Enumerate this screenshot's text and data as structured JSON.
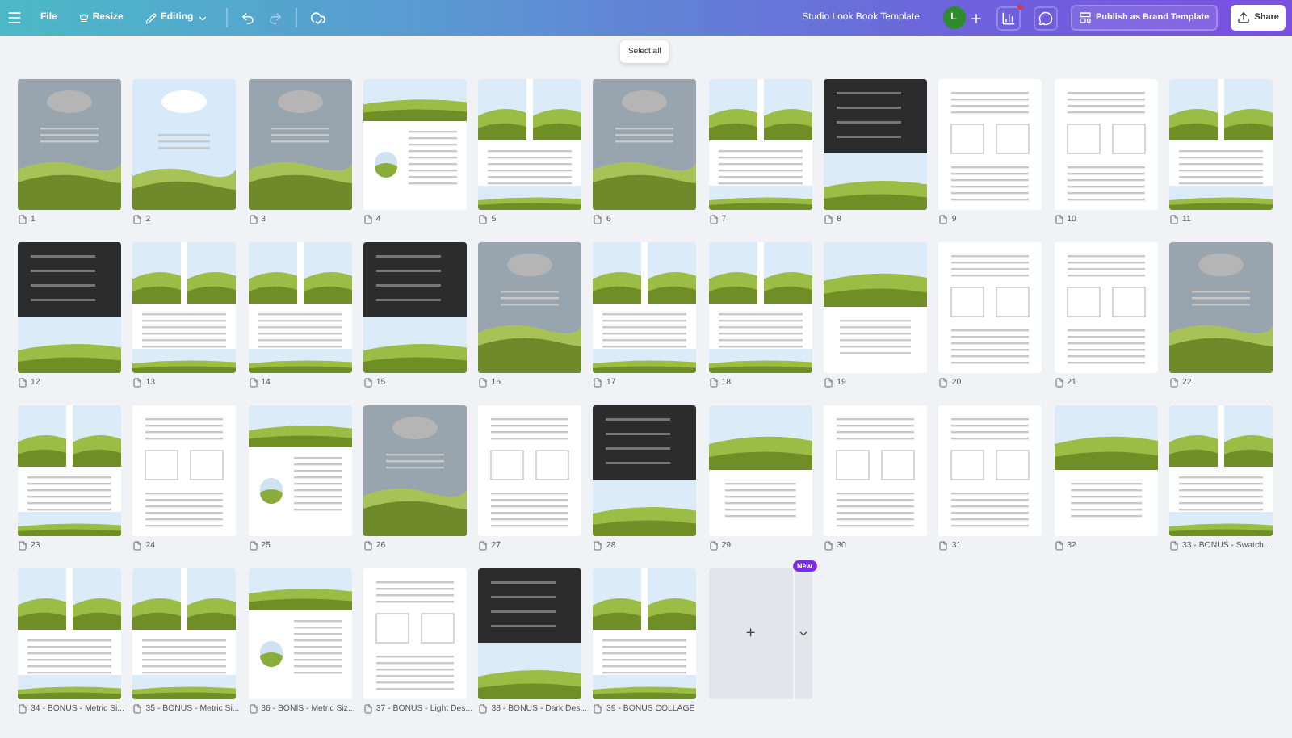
{
  "toolbar": {
    "menu": [
      "File",
      "Resize",
      "Editing"
    ],
    "title": "Studio Look Book Template",
    "avatar": "L",
    "publish": "Publish as Brand Template",
    "share": "Share"
  },
  "tooltip": "Select all",
  "pages": [
    {
      "label": "1",
      "kind": "grey"
    },
    {
      "label": "2",
      "kind": "sky"
    },
    {
      "label": "3",
      "kind": "grey"
    },
    {
      "label": "4",
      "kind": "split"
    },
    {
      "label": "5",
      "kind": "grid"
    },
    {
      "label": "6",
      "kind": "grey"
    },
    {
      "label": "7",
      "kind": "grid"
    },
    {
      "label": "8",
      "kind": "dark"
    },
    {
      "label": "9",
      "kind": "text"
    },
    {
      "label": "10",
      "kind": "text"
    },
    {
      "label": "11",
      "kind": "grid"
    },
    {
      "label": "12",
      "kind": "dark"
    },
    {
      "label": "13",
      "kind": "grid"
    },
    {
      "label": "14",
      "kind": "grid"
    },
    {
      "label": "15",
      "kind": "dark"
    },
    {
      "label": "16",
      "kind": "grey"
    },
    {
      "label": "17",
      "kind": "grid"
    },
    {
      "label": "18",
      "kind": "grid"
    },
    {
      "label": "19",
      "kind": "landscape"
    },
    {
      "label": "20",
      "kind": "text"
    },
    {
      "label": "21",
      "kind": "text"
    },
    {
      "label": "22",
      "kind": "grey"
    },
    {
      "label": "23",
      "kind": "grid"
    },
    {
      "label": "24",
      "kind": "text"
    },
    {
      "label": "25",
      "kind": "split"
    },
    {
      "label": "26",
      "kind": "grey"
    },
    {
      "label": "27",
      "kind": "text"
    },
    {
      "label": "28",
      "kind": "dark"
    },
    {
      "label": "29",
      "kind": "landscape"
    },
    {
      "label": "30",
      "kind": "text"
    },
    {
      "label": "31",
      "kind": "text"
    },
    {
      "label": "32",
      "kind": "landscape"
    },
    {
      "label": "33 - BONUS - Swatch ...",
      "kind": "grid"
    },
    {
      "label": "34 - BONUS - Metric Si...",
      "kind": "grid"
    },
    {
      "label": "35 - BONUS - Metric Si...",
      "kind": "grid"
    },
    {
      "label": "36 - BONIS - Metric Siz...",
      "kind": "split"
    },
    {
      "label": "37 - BONUS - Light Des...",
      "kind": "text"
    },
    {
      "label": "38 - BONUS - Dark Des...",
      "kind": "dark"
    },
    {
      "label": "39 - BONUS COLLAGE",
      "kind": "grid"
    }
  ],
  "add_page": {
    "symbol": "+",
    "badge": "New"
  }
}
